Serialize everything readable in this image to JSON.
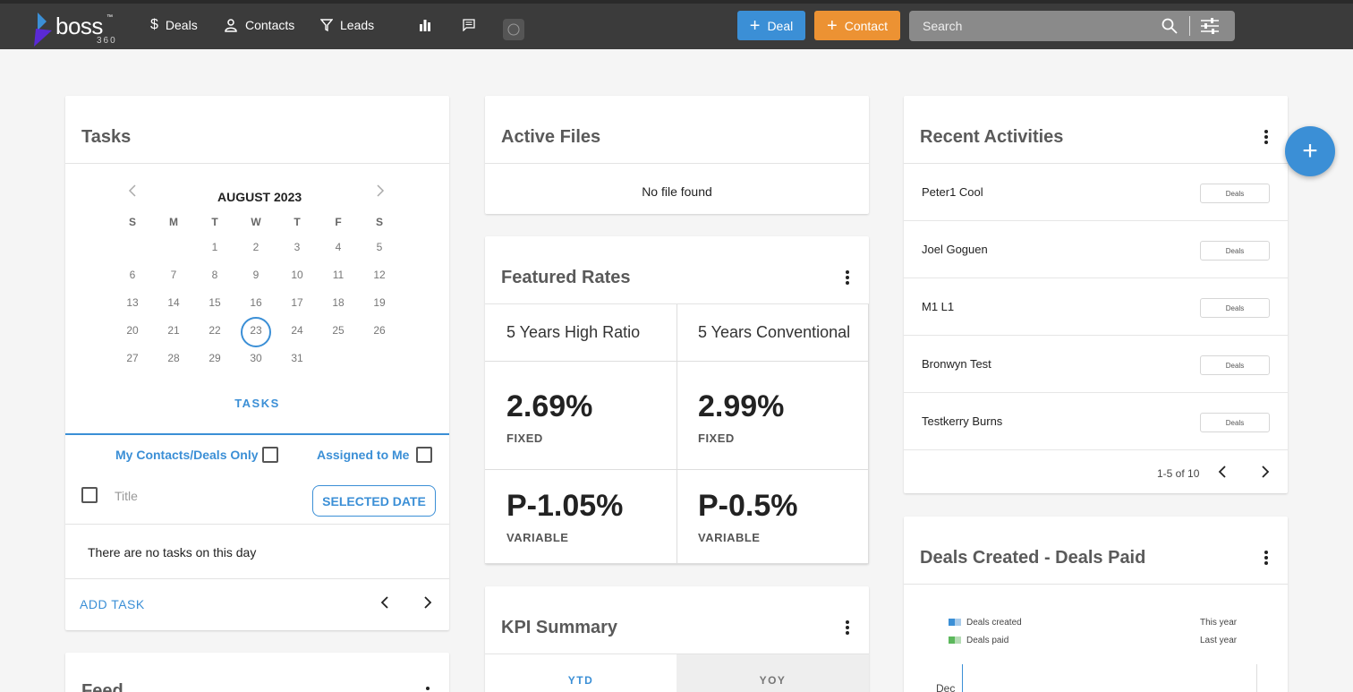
{
  "app": {
    "logo_text": "boss",
    "logo_sub": "360",
    "logo_tm": "™"
  },
  "nav": {
    "deals": "Deals",
    "contacts": "Contacts",
    "leads": "Leads",
    "icons": [
      "dollar-icon",
      "person-icon",
      "filter-icon",
      "bar-chart-icon",
      "chat-icon",
      "circle-logo-icon"
    ]
  },
  "actions": {
    "deal_label": "Deal",
    "contact_label": "Contact"
  },
  "search": {
    "placeholder": "Search"
  },
  "tasks": {
    "title": "Tasks",
    "month": "AUGUST 2023",
    "dow": [
      "S",
      "M",
      "T",
      "W",
      "T",
      "F",
      "S"
    ],
    "weeks": [
      [
        "",
        "",
        "1",
        "2",
        "3",
        "4",
        "5"
      ],
      [
        "6",
        "7",
        "8",
        "9",
        "10",
        "11",
        "12"
      ],
      [
        "13",
        "14",
        "15",
        "16",
        "17",
        "18",
        "19"
      ],
      [
        "20",
        "21",
        "22",
        "23",
        "24",
        "25",
        "26"
      ],
      [
        "27",
        "28",
        "29",
        "30",
        "31",
        "",
        ""
      ]
    ],
    "selected_day": "23",
    "tab_label": "TASKS",
    "filter_contacts": "My Contacts/Deals Only",
    "filter_assigned": "Assigned to Me",
    "title_col": "Title",
    "selected_date_btn": "SELECTED DATE",
    "empty_msg": "There are no tasks on this day",
    "add_task": "ADD TASK"
  },
  "feed": {
    "title": "Feed"
  },
  "active_files": {
    "title": "Active Files",
    "empty": "No file found"
  },
  "featured_rates": {
    "title": "Featured Rates",
    "columns": [
      {
        "name": "5 Years High Ratio",
        "fixed": "2.69%",
        "fixed_label": "FIXED",
        "variable": "P-1.05%",
        "variable_label": "VARIABLE"
      },
      {
        "name": "5 Years Conventional",
        "fixed": "2.99%",
        "fixed_label": "FIXED",
        "variable": "P-0.5%",
        "variable_label": "VARIABLE"
      }
    ]
  },
  "kpi": {
    "title": "KPI Summary",
    "tabs": [
      "YTD",
      "YOY"
    ]
  },
  "recent": {
    "title": "Recent Activities",
    "rows": [
      {
        "name": "Peter1 Cool",
        "tag": "Deals"
      },
      {
        "name": "Joel Goguen",
        "tag": "Deals"
      },
      {
        "name": "M1 L1",
        "tag": "Deals"
      },
      {
        "name": "Bronwyn Test",
        "tag": "Deals"
      },
      {
        "name": "Testkerry Burns",
        "tag": "Deals"
      }
    ],
    "pagination": "1-5 of 10"
  },
  "deals_chart": {
    "title": "Deals Created - Deals Paid",
    "legend": [
      {
        "label": "Deals created",
        "period": "This year",
        "color": "#3b8fd6"
      },
      {
        "label": "Deals paid",
        "period": "Last year",
        "color": "#5cb85c"
      }
    ],
    "first_category": "Dec"
  },
  "colors": {
    "accent": "#3b8fd6",
    "orange": "#ec9233",
    "topbar": "#3b3b3b"
  }
}
